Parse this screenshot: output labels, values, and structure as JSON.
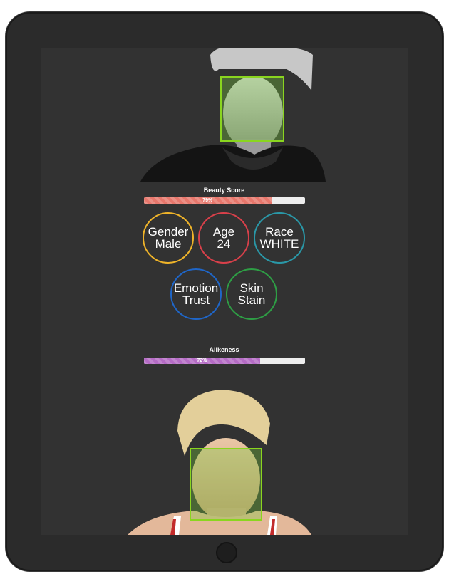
{
  "beauty": {
    "label": "Beauty Score",
    "value_text": "79%",
    "value": 0.79,
    "color": "#e7776c"
  },
  "alikeness": {
    "label": "Alikeness",
    "value_text": "72%",
    "value": 0.72,
    "color": "#b56cc5"
  },
  "attributes": [
    {
      "title": "Gender",
      "value": "Male",
      "color": "#f0b429"
    },
    {
      "title": "Age",
      "value": "24",
      "color": "#d9404a"
    },
    {
      "title": "Race",
      "value": "WHITE",
      "color": "#2a98a8"
    },
    {
      "title": "Emotion",
      "value": "Trust",
      "color": "#1f66c8"
    },
    {
      "title": "Skin",
      "value": "Stain",
      "color": "#2e9e45"
    }
  ],
  "colors": {
    "face_box": "#8ad51f",
    "screen": "#323232",
    "bezel": "#2b2b2b"
  }
}
